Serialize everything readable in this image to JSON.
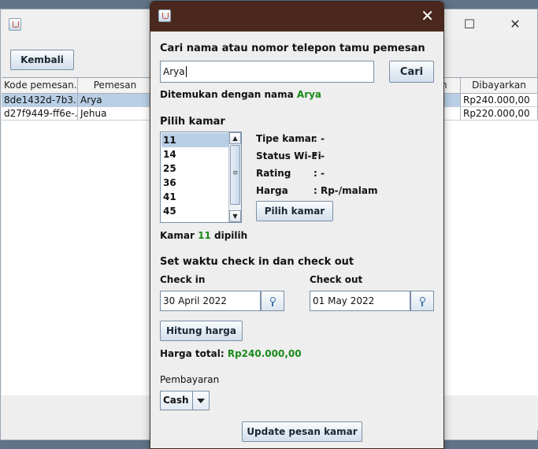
{
  "main_window": {
    "back_button": "Kembali",
    "columns": [
      "Kode pemesan...",
      "Pemesan",
      "n",
      "Dibayarkan"
    ],
    "rows": [
      {
        "kode": "8de1432d-7b3...",
        "pemesan": "Arya",
        "dibayarkan": "Rp240.000,00",
        "selected": true
      },
      {
        "kode": "d27f9449-ff6e-...",
        "pemesan": "Jehua",
        "dibayarkan": "Rp220.000,00",
        "selected": false
      }
    ]
  },
  "dialog": {
    "search_label": "Cari nama atau nomor telepon tamu pemesan",
    "search_value": "Arya",
    "search_button": "Cari",
    "found_prefix": "Ditemukan dengan nama",
    "found_name": "Arya",
    "room_section": "Pilih kamar",
    "rooms": [
      "11",
      "14",
      "25",
      "36",
      "41",
      "45"
    ],
    "selected_room": "11",
    "room_info": [
      {
        "label": "Tipe kamar",
        "value": ": -"
      },
      {
        "label": "Status Wi-Fi",
        "value": ": -"
      },
      {
        "label": "Rating",
        "value": ": -"
      },
      {
        "label": "Harga",
        "value": ": Rp-/malam"
      }
    ],
    "pick_room_button": "Pilih kamar",
    "room_chosen_prefix": "Kamar",
    "room_chosen_number": "11",
    "room_chosen_suffix": "dipilih",
    "time_section": "Set waktu check in dan check out",
    "checkin_label": "Check in",
    "checkin_value": "30 April 2022",
    "checkout_label": "Check out",
    "checkout_value": "01 May 2022",
    "calc_button": "Hitung harga",
    "total_label": "Harga total:",
    "total_value": "Rp240.000,00",
    "payment_label": "Pembayaran",
    "payment_value": "Cash",
    "update_button": "Update pesan kamar"
  }
}
